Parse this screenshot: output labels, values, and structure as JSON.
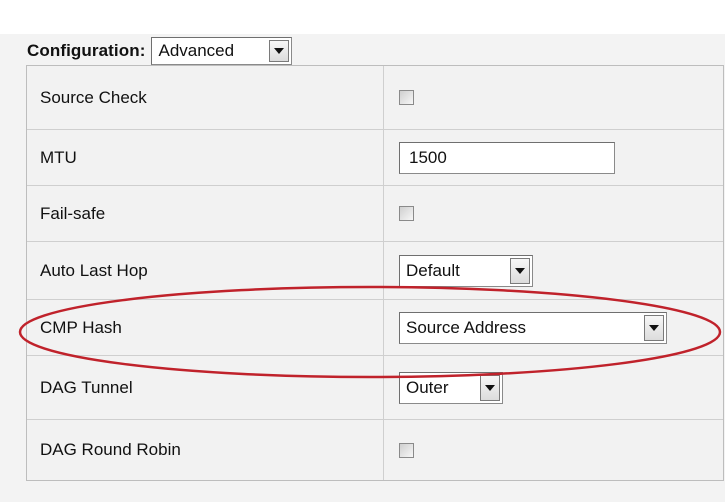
{
  "configuration": {
    "label": "Configuration:",
    "selected": "Advanced"
  },
  "rows": [
    {
      "label": "Source Check",
      "control": "checkbox",
      "checked": false
    },
    {
      "label": "MTU",
      "control": "text",
      "value": "1500"
    },
    {
      "label": "Fail-safe",
      "control": "checkbox",
      "checked": false
    },
    {
      "label": "Auto Last Hop",
      "control": "select",
      "value": "Default"
    },
    {
      "label": "CMP Hash",
      "control": "select",
      "value": "Source Address",
      "highlighted": true
    },
    {
      "label": "DAG Tunnel",
      "control": "select",
      "value": "Outer"
    },
    {
      "label": "DAG Round Robin",
      "control": "checkbox",
      "checked": false
    }
  ],
  "colors": {
    "highlight_ellipse": "#c0222b",
    "panel_background": "#f2f2f2"
  }
}
